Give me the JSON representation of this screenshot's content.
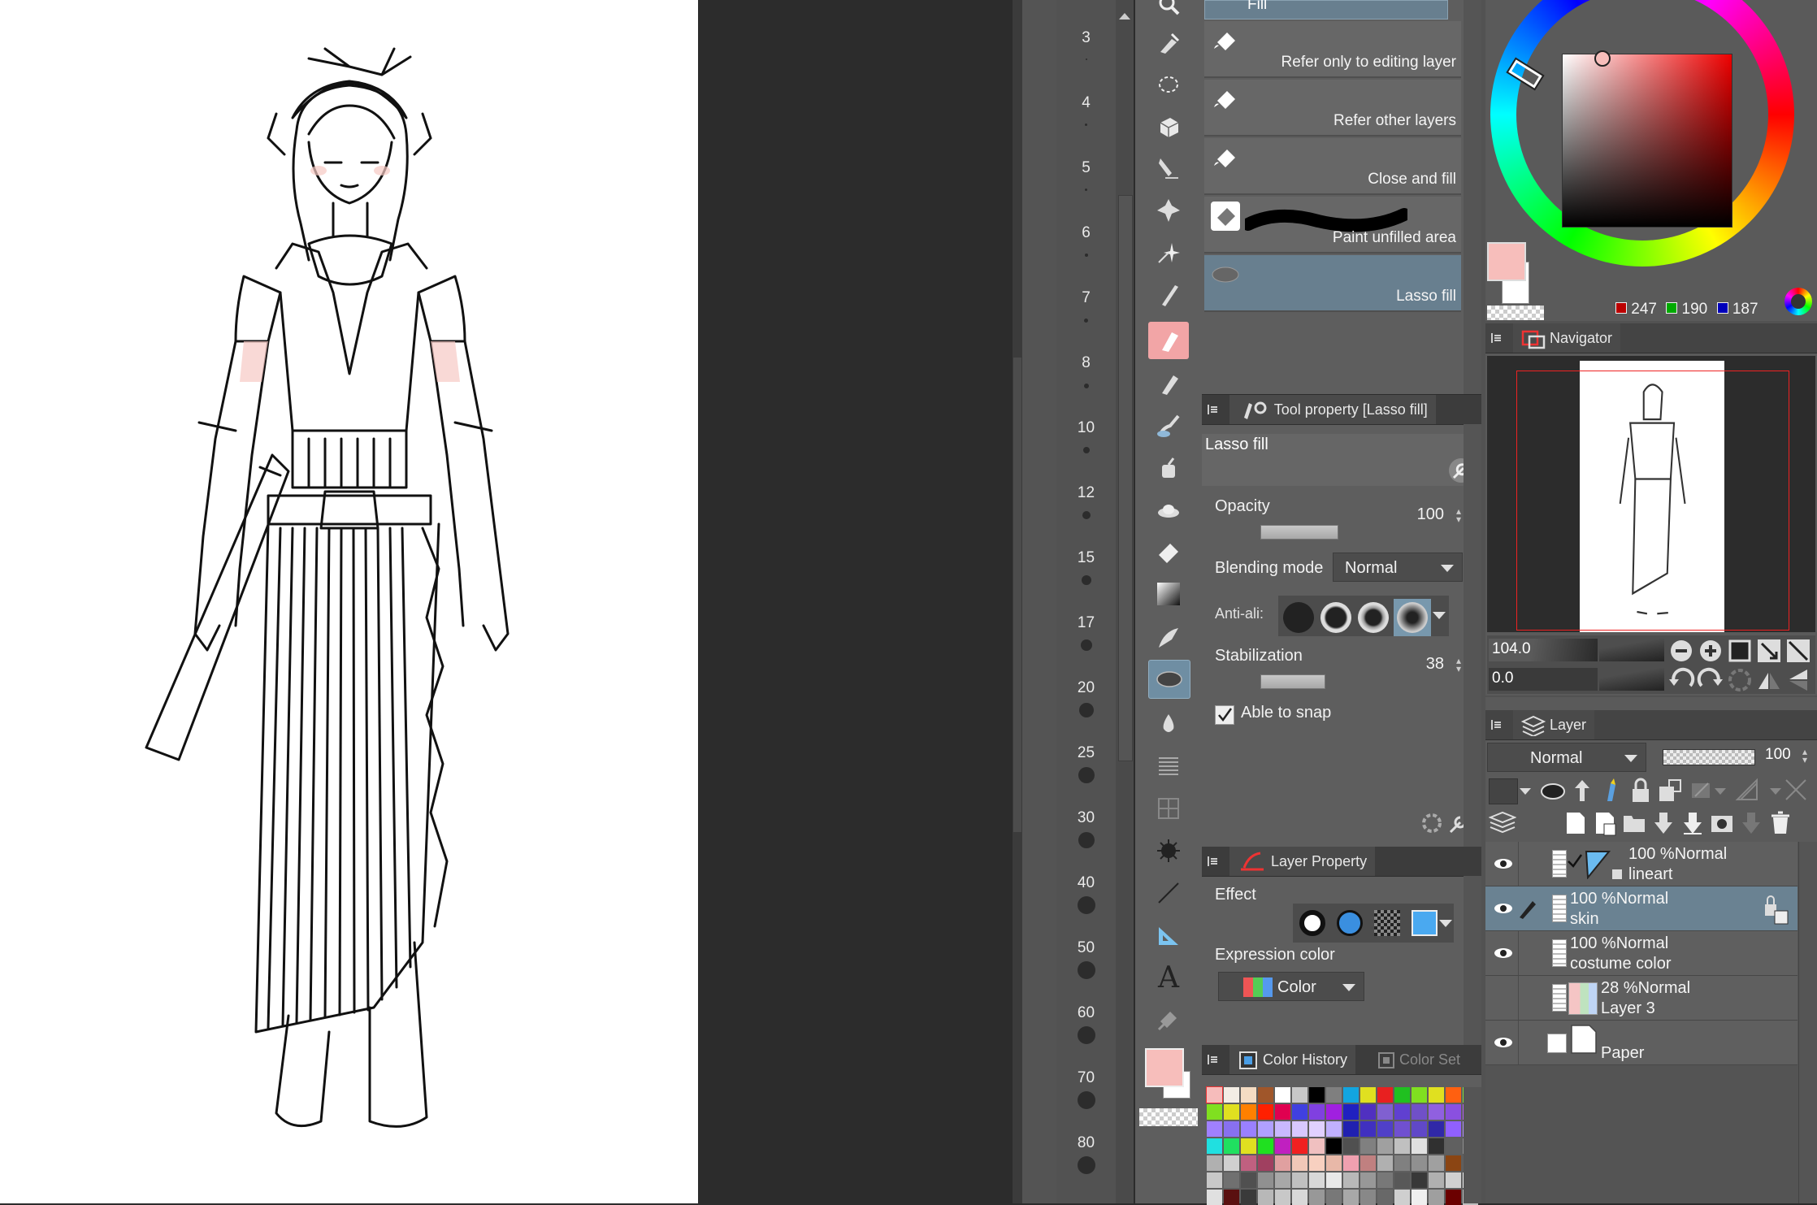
{
  "brush_size_palette": {
    "sizes": [
      "3",
      "4",
      "5",
      "6",
      "7",
      "8",
      "10",
      "12",
      "15",
      "17",
      "20",
      "25",
      "30",
      "40",
      "50",
      "60",
      "70",
      "80"
    ]
  },
  "sub_tool": {
    "group_title": "Fill",
    "items": [
      {
        "label": "Refer only to editing layer",
        "selected": false
      },
      {
        "label": "Refer other layers",
        "selected": false
      },
      {
        "label": "Close and fill",
        "selected": false
      },
      {
        "label": "Paint unfilled area",
        "selected": false
      },
      {
        "label": "Lasso fill",
        "selected": true
      }
    ]
  },
  "tool_property": {
    "tab_label": "Tool property [Lasso fill]",
    "tool_name": "Lasso fill",
    "opacity_label": "Opacity",
    "opacity_value": "100",
    "opacity_fraction": 1.0,
    "blending_label": "Blending mode",
    "blending_value": "Normal",
    "antialias_label": "Anti-ali:",
    "stabilization_label": "Stabilization",
    "stabilization_value": "38",
    "stabilization_fraction": 0.38,
    "snap_label": "Able to snap",
    "snap_checked": true
  },
  "layer_property": {
    "tab_label": "Layer Property",
    "effect_label": "Effect",
    "expression_label": "Expression color",
    "expression_value": "Color"
  },
  "color_history": {
    "tab_label": "Color History",
    "tab2_label": "Color Set",
    "swatches": [
      "#f6bcbb",
      "#f3ede5",
      "#f4dcc3",
      "#a0562a",
      "#ffffff",
      "#c8c8c8",
      "#000000",
      "#7f7f7f",
      "#12a5e0",
      "#e0e020",
      "#e82020",
      "#20c020",
      "#80e020",
      "#e0e020",
      "#ff6010",
      "#80e040",
      "#80e020",
      "#e0e020",
      "#ff8000",
      "#ff2000",
      "#e00050",
      "#4040e0",
      "#8040e0",
      "#a020e0",
      "#2020c0",
      "#5030c0",
      "#8060d0",
      "#6040d0",
      "#7050c8",
      "#9060e0",
      "#8a50e0",
      "#b060f0",
      "#a080ff",
      "#8870f0",
      "#9a80ff",
      "#b0a0ff",
      "#c8b8ff",
      "#d8c8ff",
      "#e0d0ff",
      "#c0b0ff",
      "#2020b0",
      "#4030c0",
      "#5040c8",
      "#7050d0",
      "#6048c8",
      "#3028a8",
      "#9060ff",
      "#b090ff",
      "#20e0e0",
      "#20e060",
      "#e0e020",
      "#20e020",
      "#c020c0",
      "#f02020",
      "#f0c0c0",
      "#000000",
      "#505050",
      "#808080",
      "#a0a0a0",
      "#c0c0c0",
      "#e0e0e0",
      "#303030",
      "#606060",
      "#909090",
      "#b0b0b0",
      "#d0d0d0",
      "#c06080",
      "#a04060",
      "#e0a0a0",
      "#f0c8b8",
      "#f8d0c0",
      "#e8b8a8",
      "#f0a0b0",
      "#c08080",
      "#b0b0b0",
      "#808080",
      "#909090",
      "#a0a0a0",
      "#8b4513",
      "#606060",
      "#c8c8c8",
      "#707070",
      "#505050",
      "#909090",
      "#a8a8a8",
      "#c0c0c0",
      "#d8d8d8",
      "#e8e8e8",
      "#b8b8b8",
      "#989898",
      "#787878",
      "#585858",
      "#383838",
      "#b0b0b0",
      "#d0d0d0",
      "#f0f0f0",
      "#e0e0e0",
      "#5a1010",
      "#3a3a3a",
      "#b8b8b8",
      "#c8c8c8",
      "#d8d8d8",
      "#989898",
      "#787878",
      "#a8a8a8",
      "#888888",
      "#686868",
      "#cfcfcf",
      "#efefef",
      "#9f9f9f",
      "#6b0000",
      "#bfbfbf"
    ]
  },
  "color_wheel": {
    "r_value": "247",
    "g_value": "190",
    "b_value": "187",
    "main_color": "#f7bebb",
    "sub_color": "#ffffff"
  },
  "navigator": {
    "tab_label": "Navigator",
    "zoom_value": "104.0",
    "rotation_value": "0.0"
  },
  "layer_panel": {
    "tab_label": "Layer",
    "blend_mode": "Normal",
    "opacity": "100",
    "layers": [
      {
        "percent": "100 %",
        "mode": "Normal",
        "name": "lineart",
        "visible": true,
        "selected": false,
        "type": "vector"
      },
      {
        "percent": "100 %",
        "mode": "Normal",
        "name": "skin",
        "visible": true,
        "selected": true,
        "type": "raster"
      },
      {
        "percent": "100 %",
        "mode": "Normal",
        "name": "costume color",
        "visible": true,
        "selected": false,
        "type": "raster"
      },
      {
        "percent": "28 %",
        "mode": "Normal",
        "name": "Layer 3",
        "visible": false,
        "selected": false,
        "type": "raster"
      },
      {
        "percent": "",
        "mode": "",
        "name": "Paper",
        "visible": true,
        "selected": false,
        "type": "paper"
      }
    ]
  },
  "tool_bar": {
    "main_color": "#f7bebb",
    "sub_color": "#ffffff",
    "tools": [
      "zoom-icon",
      "move-icon",
      "lasso-select-icon",
      "object-icon",
      "eyedropper-icon",
      "vector-move-icon",
      "magic-wand-icon",
      "pen-icon",
      "pen-highlight-icon",
      "pencil-icon",
      "brush-icon",
      "airbrush-icon",
      "decoration-icon",
      "eraser-icon",
      "gradient-icon",
      "figure-icon",
      "lasso-fill-icon",
      "blend-icon",
      "hatch-icon",
      "frame-icon",
      "sparkle-icon",
      "line-icon",
      "ruler-icon",
      "text-icon",
      "correct-line-icon"
    ]
  }
}
